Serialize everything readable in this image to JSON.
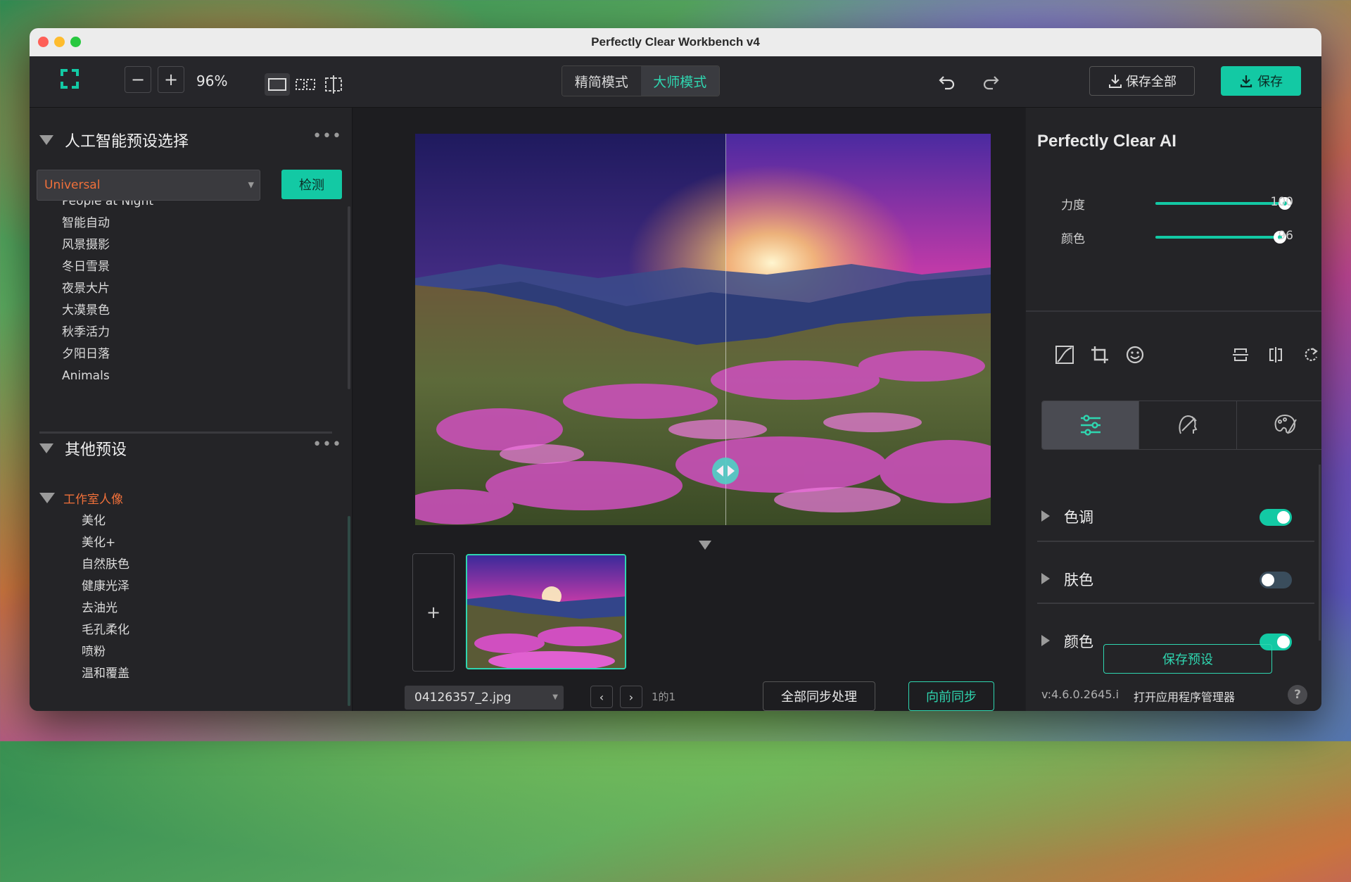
{
  "window": {
    "title": "Perfectly Clear Workbench v4"
  },
  "toolbar": {
    "zoom_out_icon": "minus-icon",
    "zoom_in_icon": "plus-icon",
    "zoom_level": "96%",
    "modes": [
      "精简模式",
      "大师模式"
    ],
    "active_mode": "大师模式",
    "save_all_label": "保存全部",
    "save_label": "保存",
    "accent": "#13c9a4"
  },
  "left_panel": {
    "ai_presets": {
      "title": "人工智能预设选择",
      "more": "•••",
      "selected": "Universal",
      "detect_label": "检测",
      "items": [
        "People at Night",
        "智能自动",
        "风景摄影",
        "冬日雪景",
        "夜景大片",
        "大漠景色",
        "秋季活力",
        "夕阳日落",
        "Animals"
      ]
    },
    "other_presets": {
      "title": "其他预设",
      "more": "•••",
      "group": "工作室人像",
      "items": [
        "美化",
        "美化+",
        "自然肤色",
        "健康光泽",
        "去油光",
        "毛孔柔化",
        "喷粉",
        "温和覆盖"
      ]
    }
  },
  "center": {
    "add_label": "+",
    "file_name": "04126357_2.jpg",
    "pager": "1的1",
    "sync_all_label": "全部同步处理",
    "sync_forward_label": "向前同步"
  },
  "right_panel": {
    "title": "Perfectly Clear AI",
    "sliders": [
      {
        "label": "力度",
        "value": 100,
        "fraction": 1.0
      },
      {
        "label": "颜色",
        "value": 96,
        "fraction": 0.96
      }
    ],
    "sections": [
      {
        "label": "色调",
        "on": true
      },
      {
        "label": "肤色",
        "on": false
      },
      {
        "label": "颜色",
        "on": true
      }
    ],
    "save_preset_label": "保存预设",
    "version": "v:4.6.0.2645.i",
    "app_manager_label": "打开应用程序管理器",
    "help": "?"
  }
}
